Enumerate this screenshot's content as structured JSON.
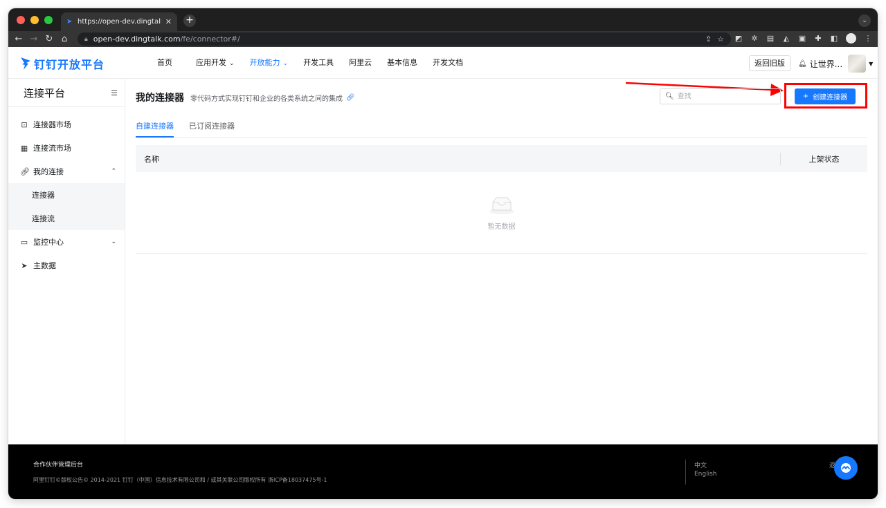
{
  "browser": {
    "tab_title": "https://open-dev.dingtalk.com/",
    "tab_close": "✕",
    "newtab": "+",
    "tab_menu": "⌄",
    "url_host": "open-dev.dingtalk.com",
    "url_path": "/fe/connector#/"
  },
  "header": {
    "logo_text": "钉钉开放平台",
    "nav": [
      {
        "label": "首页"
      },
      {
        "label": "应用开发",
        "chevron": "⌄"
      },
      {
        "label": "开放能力",
        "chevron": "⌄"
      },
      {
        "label": "开发工具"
      },
      {
        "label": "阿里云"
      },
      {
        "label": "基本信息"
      },
      {
        "label": "开发文档"
      }
    ],
    "old_version_label": "返回旧版",
    "user_name": "让世界...",
    "brand_color": "#1677ff"
  },
  "sidebar": {
    "title": "连接平台",
    "items": [
      {
        "label": "连接器市场",
        "icon": "shopping-bag-icon"
      },
      {
        "label": "连接流市场",
        "icon": "grid-icon"
      },
      {
        "label": "我的连接",
        "icon": "link-icon",
        "expanded": true
      },
      {
        "label": "连接器"
      },
      {
        "label": "连接流"
      },
      {
        "label": "监控中心",
        "icon": "chart-icon"
      },
      {
        "label": "主数据",
        "icon": "cursor-icon"
      }
    ]
  },
  "main": {
    "title": "我的连接器",
    "description": "零代码方式实现钉钉和企业的各类系统之间的集成",
    "search_placeholder": "查找",
    "create_button": "创建连接器",
    "tabs": [
      {
        "label": "自建连接器",
        "active": true
      },
      {
        "label": "已订阅连接器",
        "active": false
      }
    ],
    "table": {
      "columns": [
        "名称",
        "上架状态"
      ],
      "empty_text": "暂无数据"
    },
    "annotation_color": "#ff0000"
  },
  "footer": {
    "title": "合作伙伴管理后台",
    "copyright": "阿里钉钉©版权公告© 2014-2021 钉钉（中国）信息技术有限公司和 / 或其关联公司版权所有 浙ICP备18037475号-1",
    "lang_zh": "中文",
    "lang_en": "English",
    "extra": "返"
  }
}
